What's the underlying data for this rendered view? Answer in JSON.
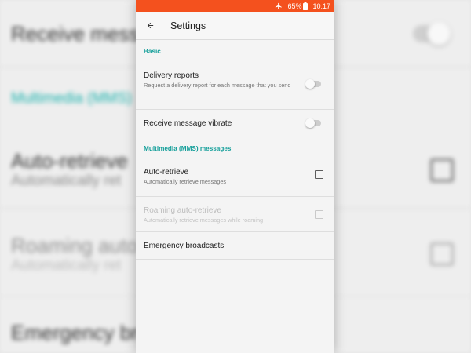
{
  "background": {
    "rows": [
      {
        "title": "Receive message"
      },
      {
        "section": "Multimedia (MMS)"
      },
      {
        "title": "Auto-retrieve",
        "subtitle": "Automatically ret"
      },
      {
        "title": "Roaming auto",
        "subtitle": "Automatically ret"
      },
      {
        "title": "Emergency bro"
      }
    ]
  },
  "status_bar": {
    "battery": "65%",
    "time": "10:17",
    "icons": [
      "airplane-icon",
      "battery-icon"
    ],
    "color": "#f4511e"
  },
  "app_bar": {
    "back_icon": "arrow-left-icon",
    "title": "Settings"
  },
  "sections": {
    "basic": {
      "header": "Basic",
      "items": {
        "delivery": {
          "title": "Delivery reports",
          "subtitle": "Request a delivery report for each message that you send",
          "control": "toggle",
          "checked": false
        },
        "vibrate": {
          "title": "Receive message vibrate",
          "control": "toggle",
          "checked": false
        }
      }
    },
    "mms": {
      "header": "Multimedia (MMS) messages",
      "items": {
        "auto_retrieve": {
          "title": "Auto-retrieve",
          "subtitle": "Automatically retrieve messages",
          "control": "checkbox",
          "checked": false
        },
        "roaming": {
          "title": "Roaming auto-retrieve",
          "subtitle": "Automatically retrieve messages while roaming",
          "control": "checkbox",
          "checked": false,
          "enabled": false
        }
      }
    }
  },
  "emergency": {
    "title": "Emergency broadcasts"
  },
  "colors": {
    "accent": "#129e99",
    "status_bar": "#f4511e"
  }
}
